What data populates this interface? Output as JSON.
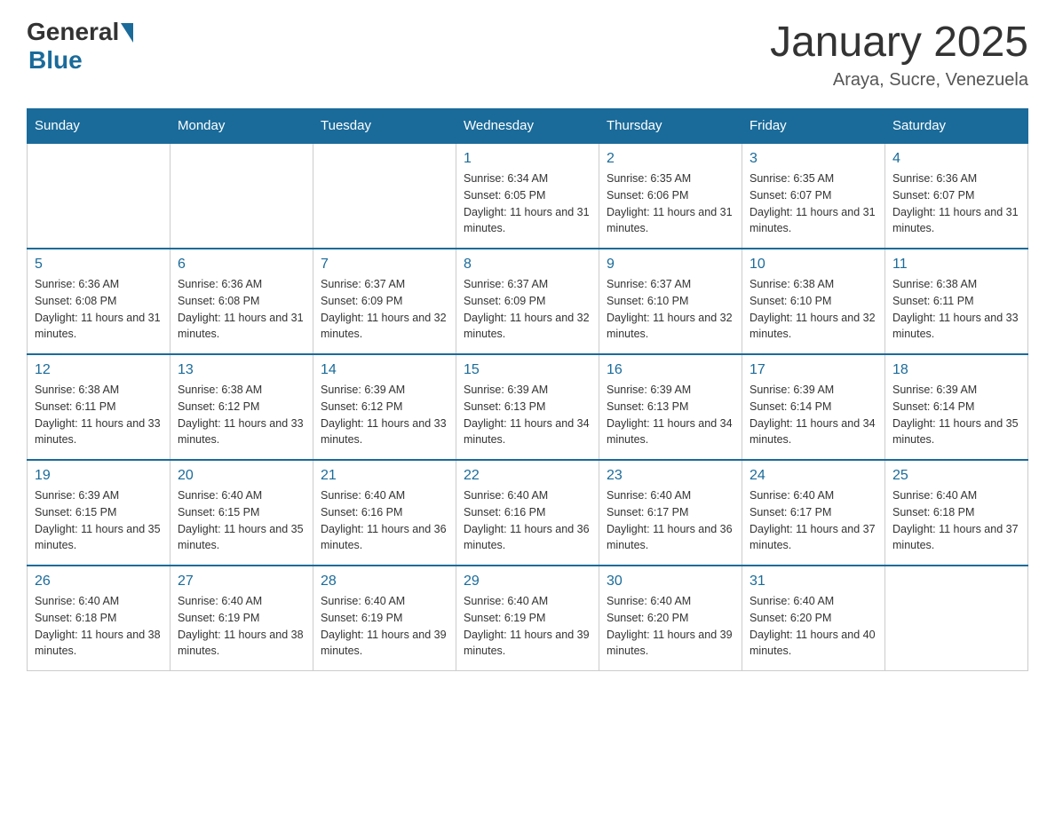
{
  "header": {
    "logo_general": "General",
    "logo_blue": "Blue",
    "month_title": "January 2025",
    "location": "Araya, Sucre, Venezuela"
  },
  "days_of_week": [
    "Sunday",
    "Monday",
    "Tuesday",
    "Wednesday",
    "Thursday",
    "Friday",
    "Saturday"
  ],
  "weeks": [
    [
      {
        "day": "",
        "info": ""
      },
      {
        "day": "",
        "info": ""
      },
      {
        "day": "",
        "info": ""
      },
      {
        "day": "1",
        "info": "Sunrise: 6:34 AM\nSunset: 6:05 PM\nDaylight: 11 hours and 31 minutes."
      },
      {
        "day": "2",
        "info": "Sunrise: 6:35 AM\nSunset: 6:06 PM\nDaylight: 11 hours and 31 minutes."
      },
      {
        "day": "3",
        "info": "Sunrise: 6:35 AM\nSunset: 6:07 PM\nDaylight: 11 hours and 31 minutes."
      },
      {
        "day": "4",
        "info": "Sunrise: 6:36 AM\nSunset: 6:07 PM\nDaylight: 11 hours and 31 minutes."
      }
    ],
    [
      {
        "day": "5",
        "info": "Sunrise: 6:36 AM\nSunset: 6:08 PM\nDaylight: 11 hours and 31 minutes."
      },
      {
        "day": "6",
        "info": "Sunrise: 6:36 AM\nSunset: 6:08 PM\nDaylight: 11 hours and 31 minutes."
      },
      {
        "day": "7",
        "info": "Sunrise: 6:37 AM\nSunset: 6:09 PM\nDaylight: 11 hours and 32 minutes."
      },
      {
        "day": "8",
        "info": "Sunrise: 6:37 AM\nSunset: 6:09 PM\nDaylight: 11 hours and 32 minutes."
      },
      {
        "day": "9",
        "info": "Sunrise: 6:37 AM\nSunset: 6:10 PM\nDaylight: 11 hours and 32 minutes."
      },
      {
        "day": "10",
        "info": "Sunrise: 6:38 AM\nSunset: 6:10 PM\nDaylight: 11 hours and 32 minutes."
      },
      {
        "day": "11",
        "info": "Sunrise: 6:38 AM\nSunset: 6:11 PM\nDaylight: 11 hours and 33 minutes."
      }
    ],
    [
      {
        "day": "12",
        "info": "Sunrise: 6:38 AM\nSunset: 6:11 PM\nDaylight: 11 hours and 33 minutes."
      },
      {
        "day": "13",
        "info": "Sunrise: 6:38 AM\nSunset: 6:12 PM\nDaylight: 11 hours and 33 minutes."
      },
      {
        "day": "14",
        "info": "Sunrise: 6:39 AM\nSunset: 6:12 PM\nDaylight: 11 hours and 33 minutes."
      },
      {
        "day": "15",
        "info": "Sunrise: 6:39 AM\nSunset: 6:13 PM\nDaylight: 11 hours and 34 minutes."
      },
      {
        "day": "16",
        "info": "Sunrise: 6:39 AM\nSunset: 6:13 PM\nDaylight: 11 hours and 34 minutes."
      },
      {
        "day": "17",
        "info": "Sunrise: 6:39 AM\nSunset: 6:14 PM\nDaylight: 11 hours and 34 minutes."
      },
      {
        "day": "18",
        "info": "Sunrise: 6:39 AM\nSunset: 6:14 PM\nDaylight: 11 hours and 35 minutes."
      }
    ],
    [
      {
        "day": "19",
        "info": "Sunrise: 6:39 AM\nSunset: 6:15 PM\nDaylight: 11 hours and 35 minutes."
      },
      {
        "day": "20",
        "info": "Sunrise: 6:40 AM\nSunset: 6:15 PM\nDaylight: 11 hours and 35 minutes."
      },
      {
        "day": "21",
        "info": "Sunrise: 6:40 AM\nSunset: 6:16 PM\nDaylight: 11 hours and 36 minutes."
      },
      {
        "day": "22",
        "info": "Sunrise: 6:40 AM\nSunset: 6:16 PM\nDaylight: 11 hours and 36 minutes."
      },
      {
        "day": "23",
        "info": "Sunrise: 6:40 AM\nSunset: 6:17 PM\nDaylight: 11 hours and 36 minutes."
      },
      {
        "day": "24",
        "info": "Sunrise: 6:40 AM\nSunset: 6:17 PM\nDaylight: 11 hours and 37 minutes."
      },
      {
        "day": "25",
        "info": "Sunrise: 6:40 AM\nSunset: 6:18 PM\nDaylight: 11 hours and 37 minutes."
      }
    ],
    [
      {
        "day": "26",
        "info": "Sunrise: 6:40 AM\nSunset: 6:18 PM\nDaylight: 11 hours and 38 minutes."
      },
      {
        "day": "27",
        "info": "Sunrise: 6:40 AM\nSunset: 6:19 PM\nDaylight: 11 hours and 38 minutes."
      },
      {
        "day": "28",
        "info": "Sunrise: 6:40 AM\nSunset: 6:19 PM\nDaylight: 11 hours and 39 minutes."
      },
      {
        "day": "29",
        "info": "Sunrise: 6:40 AM\nSunset: 6:19 PM\nDaylight: 11 hours and 39 minutes."
      },
      {
        "day": "30",
        "info": "Sunrise: 6:40 AM\nSunset: 6:20 PM\nDaylight: 11 hours and 39 minutes."
      },
      {
        "day": "31",
        "info": "Sunrise: 6:40 AM\nSunset: 6:20 PM\nDaylight: 11 hours and 40 minutes."
      },
      {
        "day": "",
        "info": ""
      }
    ]
  ]
}
